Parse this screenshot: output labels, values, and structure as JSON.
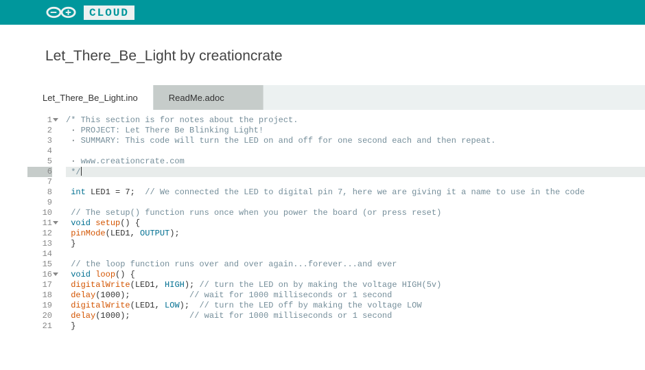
{
  "header": {
    "cloud_label": "CLOUD"
  },
  "page": {
    "title": "Let_There_Be_Light by creationcrate"
  },
  "tabs": [
    {
      "label": "Let_There_Be_Light.ino",
      "active": true
    },
    {
      "label": "ReadMe.adoc",
      "active": false
    }
  ],
  "editor": {
    "active_line": 6,
    "fold_lines": [
      1,
      11,
      16
    ],
    "lines": [
      {
        "n": 1,
        "tokens": [
          [
            "comment",
            "/* This section is for notes about the project."
          ]
        ]
      },
      {
        "n": 2,
        "tokens": [
          [
            "dot",
            " · "
          ],
          [
            "comment",
            "PROJECT: Let There Be Blinking Light!"
          ]
        ]
      },
      {
        "n": 3,
        "tokens": [
          [
            "dot",
            " · "
          ],
          [
            "comment",
            "SUMMARY: This code will turn the LED on and off for one second each and then repeat."
          ]
        ]
      },
      {
        "n": 4,
        "tokens": [
          [
            "comment",
            ""
          ]
        ]
      },
      {
        "n": 5,
        "tokens": [
          [
            "dot",
            " · "
          ],
          [
            "comment",
            "www.creationcrate.com"
          ]
        ]
      },
      {
        "n": 6,
        "tokens": [
          [
            "comment",
            " */"
          ],
          [
            "cursor",
            ""
          ]
        ]
      },
      {
        "n": 7,
        "tokens": []
      },
      {
        "n": 8,
        "tokens": [
          [
            "type",
            " int"
          ],
          [
            "ident",
            " LED1 "
          ],
          [
            "punc",
            "="
          ],
          [
            "num",
            " 7"
          ],
          [
            "punc",
            ";"
          ],
          [
            "comment",
            "  // We connected the LED to digital pin 7, here we are giving it a name to use in the code"
          ]
        ]
      },
      {
        "n": 9,
        "tokens": []
      },
      {
        "n": 10,
        "tokens": [
          [
            "comment",
            " // The setup() function runs once when you power the board (or press reset)"
          ]
        ]
      },
      {
        "n": 11,
        "tokens": [
          [
            "type",
            " void"
          ],
          [
            "ident",
            " "
          ],
          [
            "builtin",
            "setup"
          ],
          [
            "punc",
            "() {"
          ]
        ]
      },
      {
        "n": 12,
        "tokens": [
          [
            "ident",
            " "
          ],
          [
            "builtin",
            "pinMode"
          ],
          [
            "punc",
            "("
          ],
          [
            "ident",
            "LED1"
          ],
          [
            "punc",
            ", "
          ],
          [
            "const",
            "OUTPUT"
          ],
          [
            "punc",
            ");"
          ]
        ]
      },
      {
        "n": 13,
        "tokens": [
          [
            "punc",
            " }"
          ]
        ]
      },
      {
        "n": 14,
        "tokens": []
      },
      {
        "n": 15,
        "tokens": [
          [
            "comment",
            " // the loop function runs over and over again...forever...and ever"
          ]
        ]
      },
      {
        "n": 16,
        "tokens": [
          [
            "type",
            " void"
          ],
          [
            "ident",
            " "
          ],
          [
            "builtin",
            "loop"
          ],
          [
            "punc",
            "() {"
          ]
        ]
      },
      {
        "n": 17,
        "tokens": [
          [
            "ident",
            " "
          ],
          [
            "builtin",
            "digitalWrite"
          ],
          [
            "punc",
            "("
          ],
          [
            "ident",
            "LED1"
          ],
          [
            "punc",
            ", "
          ],
          [
            "const",
            "HIGH"
          ],
          [
            "punc",
            ");"
          ],
          [
            "comment",
            " // turn the LED on by making the voltage HIGH(5v)"
          ]
        ]
      },
      {
        "n": 18,
        "tokens": [
          [
            "ident",
            " "
          ],
          [
            "builtin",
            "delay"
          ],
          [
            "punc",
            "("
          ],
          [
            "num",
            "1000"
          ],
          [
            "punc",
            ");"
          ],
          [
            "comment",
            "            // wait for 1000 milliseconds or 1 second"
          ]
        ]
      },
      {
        "n": 19,
        "tokens": [
          [
            "ident",
            " "
          ],
          [
            "builtin",
            "digitalWrite"
          ],
          [
            "punc",
            "("
          ],
          [
            "ident",
            "LED1"
          ],
          [
            "punc",
            ", "
          ],
          [
            "const",
            "LOW"
          ],
          [
            "punc",
            ");"
          ],
          [
            "comment",
            "  // turn the LED off by making the voltage LOW"
          ]
        ]
      },
      {
        "n": 20,
        "tokens": [
          [
            "ident",
            " "
          ],
          [
            "builtin",
            "delay"
          ],
          [
            "punc",
            "("
          ],
          [
            "num",
            "1000"
          ],
          [
            "punc",
            ");"
          ],
          [
            "comment",
            "            // wait for 1000 milliseconds or 1 second"
          ]
        ]
      },
      {
        "n": 21,
        "tokens": [
          [
            "punc",
            " }"
          ]
        ]
      }
    ]
  }
}
